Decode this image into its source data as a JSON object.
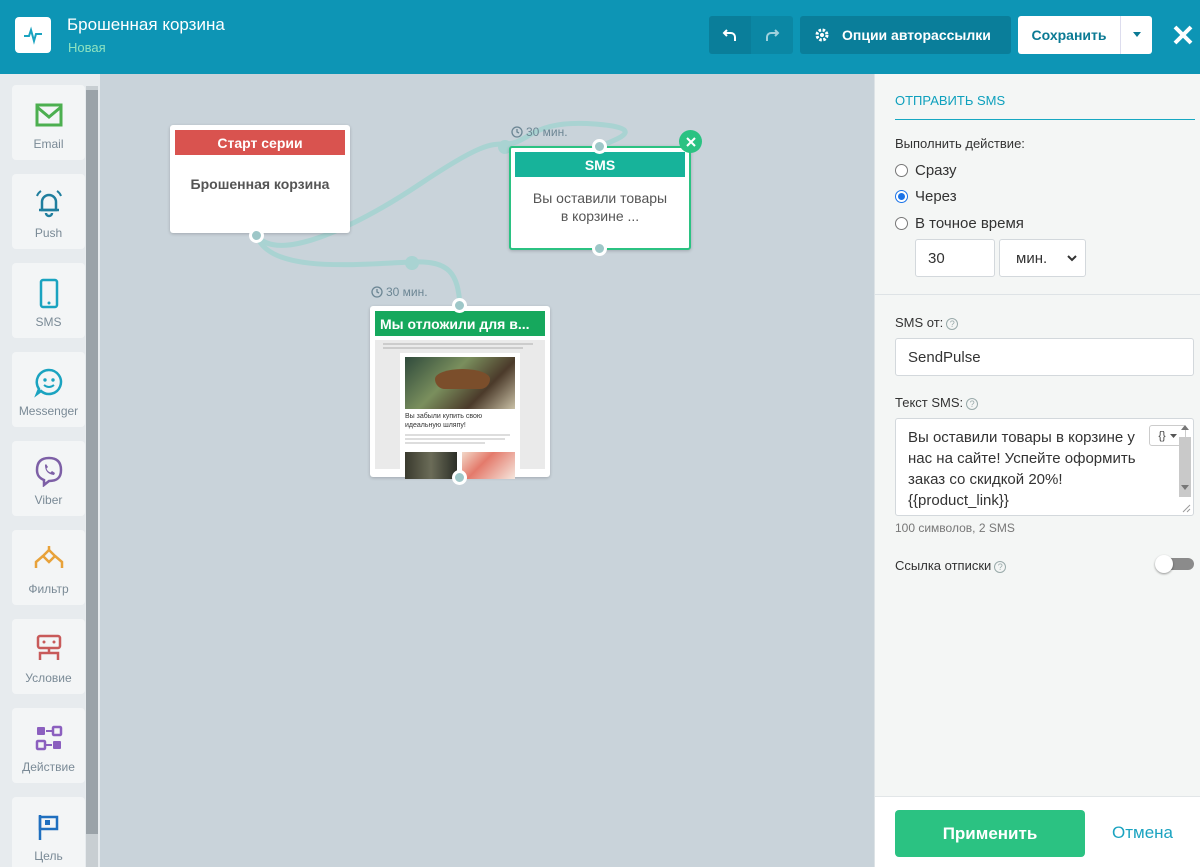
{
  "header": {
    "title": "Брошенная корзина",
    "subtitle": "Новая",
    "options_label": "Опции авторассылки",
    "save_label": "Сохранить"
  },
  "toolbar": {
    "items": [
      {
        "label": "Email",
        "icon": "envelope-icon",
        "color": "#4caf50"
      },
      {
        "label": "Push",
        "icon": "bell-icon",
        "color": "#1f7e9e"
      },
      {
        "label": "SMS",
        "icon": "phone-icon",
        "color": "#1aa3c0"
      },
      {
        "label": "Messenger",
        "icon": "chat-icon",
        "color": "#1aa3c0"
      },
      {
        "label": "Viber",
        "icon": "viber-icon",
        "color": "#7d5fa6"
      },
      {
        "label": "Фильтр",
        "icon": "filter-icon",
        "color": "#e8a23a"
      },
      {
        "label": "Условие",
        "icon": "condition-icon",
        "color": "#c85a5a"
      },
      {
        "label": "Действие",
        "icon": "action-icon",
        "color": "#8b5fbf"
      },
      {
        "label": "Цель",
        "icon": "flag-icon",
        "color": "#1f6fbf"
      }
    ]
  },
  "canvas": {
    "start_node": {
      "head": "Старт серии",
      "body": "Брошенная корзина",
      "color": "#d9534f"
    },
    "sms_node": {
      "head": "SMS",
      "body": "Вы оставили товары в корзине ...",
      "color": "#17b39a"
    },
    "email_node": {
      "head": "Мы отложили для в...",
      "color": "#16a85d",
      "preview_heading": "Вы забыли купить свою идеальную шляпу!"
    },
    "timer1": "30 мин.",
    "timer2": "30 мин."
  },
  "panel": {
    "title": "ОТПРАВИТЬ SMS",
    "action_label": "Выполнить действие:",
    "radio_options": [
      "Сразу",
      "Через",
      "В точное время"
    ],
    "selected_radio": "Через",
    "delay_value": "30",
    "delay_unit": "мин.",
    "sender_label": "SMS от:",
    "sender_value": "SendPulse",
    "text_label": "Текст SMS:",
    "text_value": "Вы оставили товары в корзине у нас на сайте! Успейте оформить заказ со скидкой 20%! {{product_link}}",
    "var_button": "{}",
    "counter": "100 символов, 2 SMS",
    "unsub_label": "Ссылка отписки",
    "apply_label": "Применить",
    "cancel_label": "Отмена"
  }
}
